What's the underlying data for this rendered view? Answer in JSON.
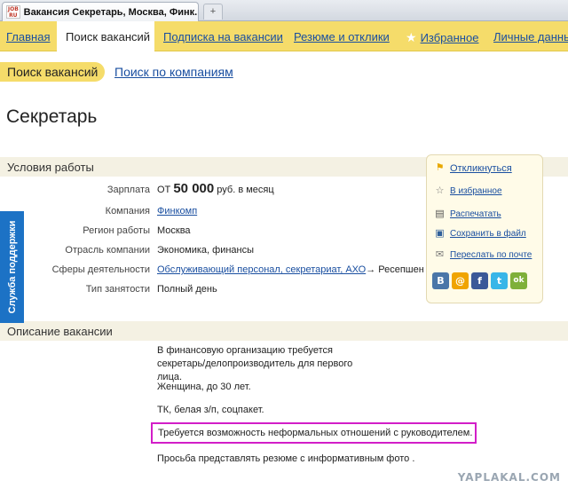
{
  "browser": {
    "favicon_text": "JOB RU",
    "tab_title": "Вакансия Секретарь, Москва, Финк...",
    "new_tab_icon": "new-tab"
  },
  "topnav": {
    "items": [
      "Главная",
      "Поиск вакансий",
      "Подписка на вакансии",
      "Резюме и отклики",
      "Избранное",
      "Личные данны"
    ],
    "active_index": 1,
    "bg_color": "#f5dc6a"
  },
  "subnav": {
    "active": "Поиск вакансий",
    "link": "Поиск по компаниям"
  },
  "vacancy": {
    "title": "Секретарь",
    "conditions_heading": "Условия работы",
    "salary": {
      "label": "Зарплата",
      "prefix": "от",
      "amount": "50 000",
      "suffix": "руб. в месяц"
    },
    "company": {
      "label": "Компания",
      "value": "Финкомп"
    },
    "region": {
      "label": "Регион работы",
      "value": "Москва"
    },
    "industry": {
      "label": "Отрасль компании",
      "value": "Экономика, финансы"
    },
    "sphere": {
      "label": "Сферы деятельности",
      "value": "Обслуживающий персонал, секретариат, АХО",
      "arrow": "→",
      "tail": "Ресепшен"
    },
    "employment": {
      "label": "Тип занятости",
      "value": "Полный день"
    },
    "description_heading": "Описание вакансии",
    "description": [
      "В финансовую организацию требуется секретарь/делопроизводитель для первого лица.",
      "Женщина, до 30 лет.",
      "ТК, белая з/п, соцпакет.",
      "Требуется возможность неформальных отношений с руководителем.",
      "Просьба представлять резюме с информативным фото ."
    ],
    "highlight_color": "#d21ec8"
  },
  "actions": {
    "respond": "Откликнуться",
    "favorite": "В избранное",
    "print": "Распечатать",
    "save": "Сохранить в файл",
    "send": "Переслать по почте",
    "social": [
      {
        "name": "vk",
        "label": "B",
        "color": "#4a76a8"
      },
      {
        "name": "mailru",
        "label": "@",
        "color": "#f0a400"
      },
      {
        "name": "facebook",
        "label": "f",
        "color": "#3b5998"
      },
      {
        "name": "twitter",
        "label": "t",
        "color": "#38b6e8"
      },
      {
        "name": "odnoklassniki",
        "label": "ok",
        "color": "#7fb03a"
      }
    ]
  },
  "support": {
    "label": "Служба поддержки",
    "color": "#1c72c5"
  },
  "watermark": "YAPLAKAL.COM"
}
